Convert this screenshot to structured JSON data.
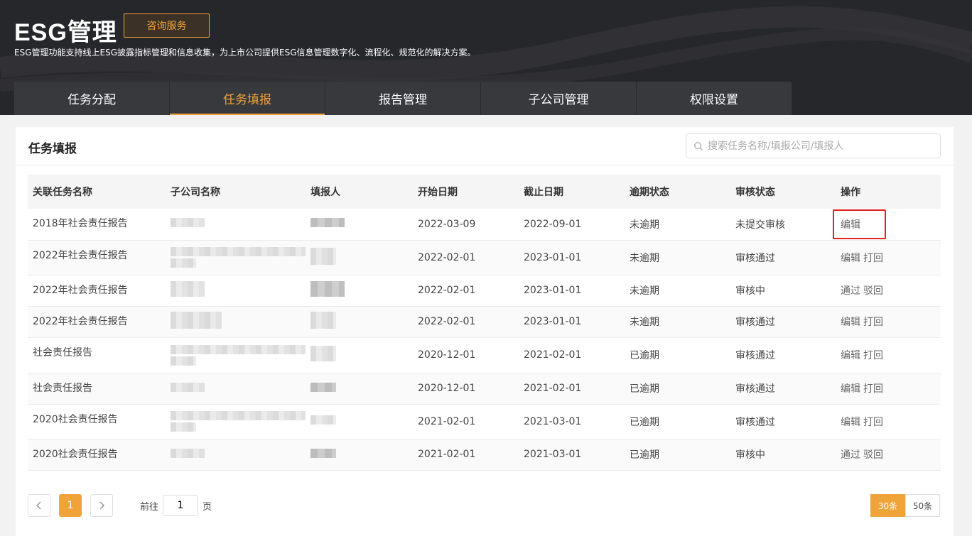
{
  "header": {
    "title": "ESG管理",
    "consult_label": "咨询服务",
    "subtitle": "ESG管理功能支持线上ESG披露指标管理和信息收集，为上市公司提供ESG信息管理数字化、流程化、规范化的解决方案。"
  },
  "tabs": [
    {
      "label": "任务分配"
    },
    {
      "label": "任务填报"
    },
    {
      "label": "报告管理"
    },
    {
      "label": "子公司管理"
    },
    {
      "label": "权限设置"
    }
  ],
  "panel": {
    "title": "任务填报",
    "search_placeholder": "搜索任务名称/填报公司/填报人"
  },
  "table": {
    "headers": [
      "关联任务名称",
      "子公司名称",
      "填报人",
      "开始日期",
      "截止日期",
      "逾期状态",
      "审核状态",
      "操作"
    ],
    "rows": [
      {
        "task": "2018年社会责任报告",
        "start": "2022-03-09",
        "end": "2022-09-01",
        "overdue": "未逾期",
        "review": "未提交审核",
        "op1": "编辑",
        "op2": ""
      },
      {
        "task": "2022年社会责任报告",
        "start": "2022-02-01",
        "end": "2023-01-01",
        "overdue": "未逾期",
        "review": "审核通过",
        "op1": "编辑",
        "op2": "打回"
      },
      {
        "task": "2022年社会责任报告",
        "start": "2022-02-01",
        "end": "2023-01-01",
        "overdue": "未逾期",
        "review": "审核中",
        "op1": "通过",
        "op2": "驳回"
      },
      {
        "task": "2022年社会责任报告",
        "start": "2022-02-01",
        "end": "2023-01-01",
        "overdue": "未逾期",
        "review": "审核通过",
        "op1": "编辑",
        "op2": "打回"
      },
      {
        "task": "社会责任报告",
        "start": "2020-12-01",
        "end": "2021-02-01",
        "overdue": "已逾期",
        "review": "审核通过",
        "op1": "编辑",
        "op2": "打回"
      },
      {
        "task": "社会责任报告",
        "start": "2020-12-01",
        "end": "2021-02-01",
        "overdue": "已逾期",
        "review": "审核通过",
        "op1": "编辑",
        "op2": "打回"
      },
      {
        "task": "2020社会责任报告",
        "start": "2021-02-01",
        "end": "2021-03-01",
        "overdue": "已逾期",
        "review": "审核通过",
        "op1": "编辑",
        "op2": "打回"
      },
      {
        "task": "2020社会责任报告",
        "start": "2021-02-01",
        "end": "2021-03-01",
        "overdue": "已逾期",
        "review": "审核中",
        "op1": "通过",
        "op2": "驳回"
      }
    ]
  },
  "pagination": {
    "current_page": "1",
    "goto_prefix": "前往",
    "goto_value": "1",
    "goto_suffix": "页",
    "sizes": [
      "30条",
      "50条"
    ]
  },
  "colors": {
    "accent": "#f0a338",
    "header_bg": "#26272b",
    "highlight": "#e02020"
  }
}
